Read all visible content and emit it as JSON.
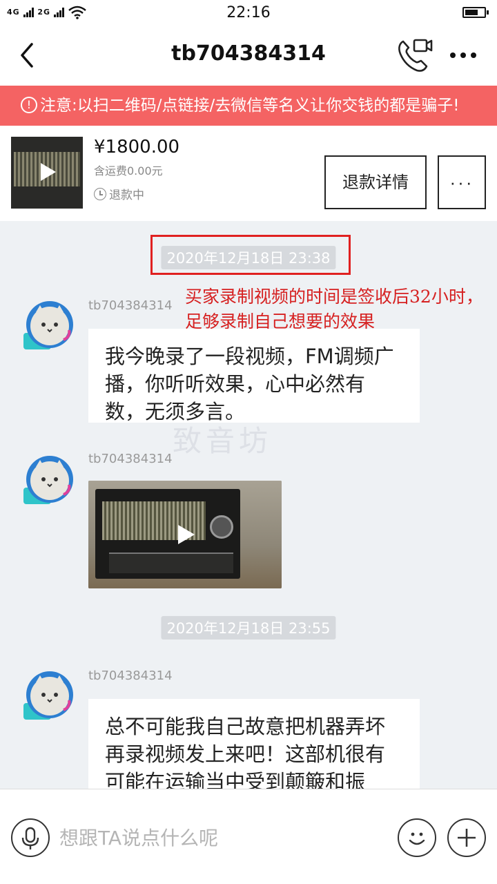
{
  "status_bar": {
    "network_1": "4G",
    "network_2": "2G",
    "network_3": "2G",
    "time": "22:16",
    "battery_level": 0.7
  },
  "nav": {
    "title": "tb704384314",
    "back_icon": "chevron-left-icon",
    "call_icon": "phone-video-icon",
    "more_icon": "more-horizontal-icon"
  },
  "warning": {
    "icon": "alert-circle-icon",
    "text": "注意:以扫二维码/点链接/去微信等名义让你交钱的都是骗子!"
  },
  "order": {
    "price": "¥1800.00",
    "shipping": "含运费0.00元",
    "status": "退款中",
    "refund_button": "退款详情",
    "more_button": "···"
  },
  "messages": {
    "timestamp_1": "2020年12月18日 23:38",
    "annotation": "买家录制视频的时间是签收后32小时，足够录制自己想要的效果",
    "sender_1": "tb704384314",
    "text_1": "我今晚录了一段视频，FM调频广播，你听听效果，心中必然有数，无须多言。",
    "sender_2": "tb704384314",
    "timestamp_2": "2020年12月18日 23:55",
    "sender_3": "tb704384314",
    "text_3": "总不可能我自己故意把机器弄坏再录视频发上来吧！这部机很有可能在运输当中受到颠簸和振动，有些零件功能受到影"
  },
  "input": {
    "placeholder": "想跟TA说点什么呢",
    "mic_icon": "microphone-icon",
    "emoji_icon": "smiley-icon",
    "plus_icon": "plus-icon"
  },
  "colors": {
    "warning_bg": "#f46363",
    "annotation_red": "#d62020",
    "chat_bg": "#eef1f4"
  }
}
